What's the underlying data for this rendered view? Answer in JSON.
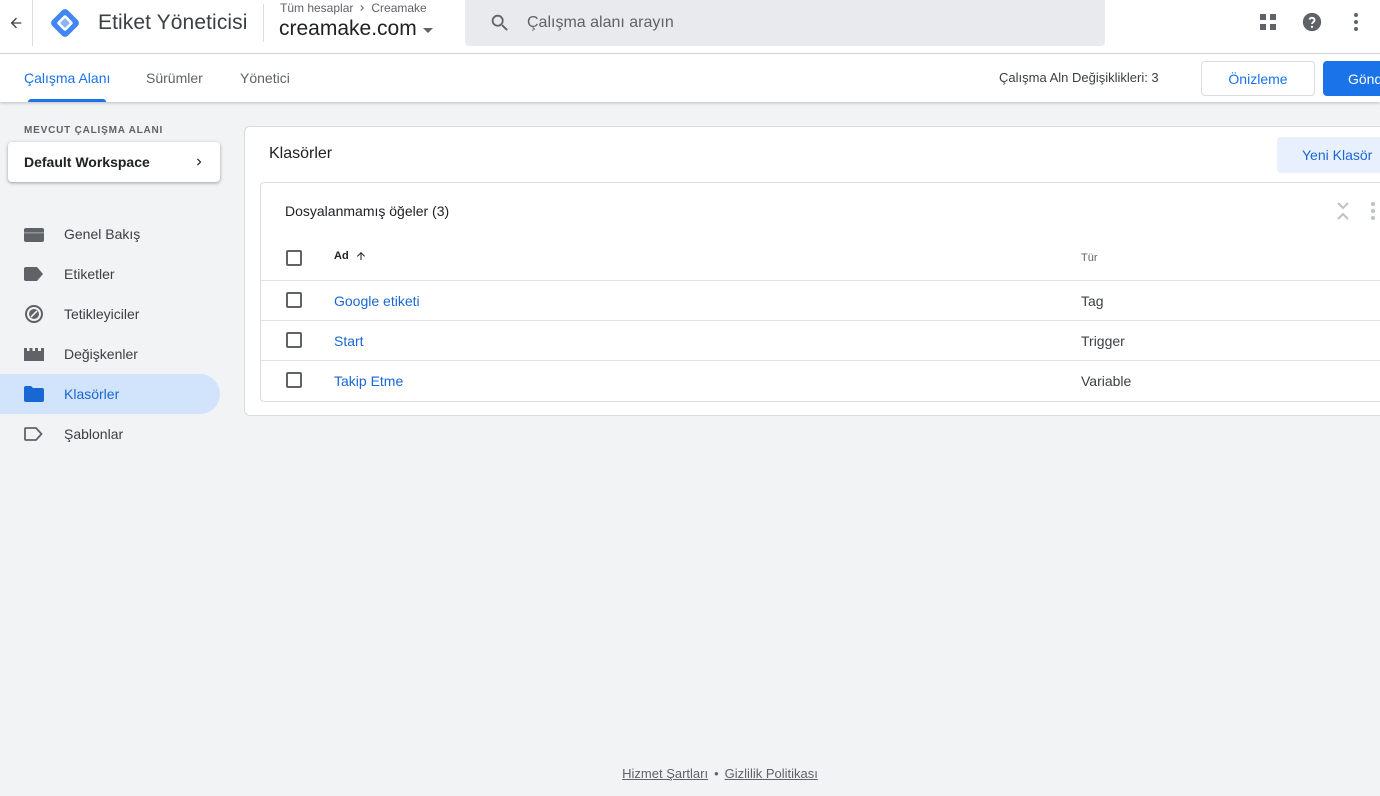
{
  "header": {
    "app_title": "Etiket Yöneticisi",
    "breadcrumb_root": "Tüm hesaplar",
    "breadcrumb_account": "Creamake",
    "container_name": "creamake.com",
    "search_placeholder": "Çalışma alanı arayın"
  },
  "nav": {
    "tabs": [
      "Çalışma Alanı",
      "Sürümler",
      "Yönetici"
    ],
    "changes_text": "Çalışma Aln Değişiklikleri: 3",
    "preview_label": "Önizleme",
    "submit_label": "Gönder"
  },
  "sidebar": {
    "workspace_label": "MEVCUT ÇALIŞMA ALANI",
    "workspace_name": "Default Workspace",
    "items": [
      {
        "label": "Genel Bakış",
        "icon": "briefcase-icon"
      },
      {
        "label": "Etiketler",
        "icon": "tag-icon"
      },
      {
        "label": "Tetikleyiciler",
        "icon": "trigger-icon"
      },
      {
        "label": "Değişkenler",
        "icon": "variables-icon"
      },
      {
        "label": "Klasörler",
        "icon": "folder-icon"
      },
      {
        "label": "Şablonlar",
        "icon": "template-icon"
      }
    ],
    "active_index": 4
  },
  "main": {
    "title": "Klasörler",
    "new_folder_label": "Yeni Klasör",
    "folder_title": "Dosyalanmamış öğeler (3)",
    "columns": {
      "name": "Ad",
      "type": "Tür"
    },
    "rows": [
      {
        "name": "Google etiketi",
        "type": "Tag"
      },
      {
        "name": "Start",
        "type": "Trigger"
      },
      {
        "name": "Takip Etme",
        "type": "Variable"
      }
    ]
  },
  "footer": {
    "terms": "Hizmet Şartları",
    "separator": "•",
    "privacy": "Gizlilik Politikası"
  },
  "colors": {
    "accent": "#1a73e8",
    "active_nav_bg": "#d2e3fc",
    "page_bg": "#f1f3f4"
  }
}
